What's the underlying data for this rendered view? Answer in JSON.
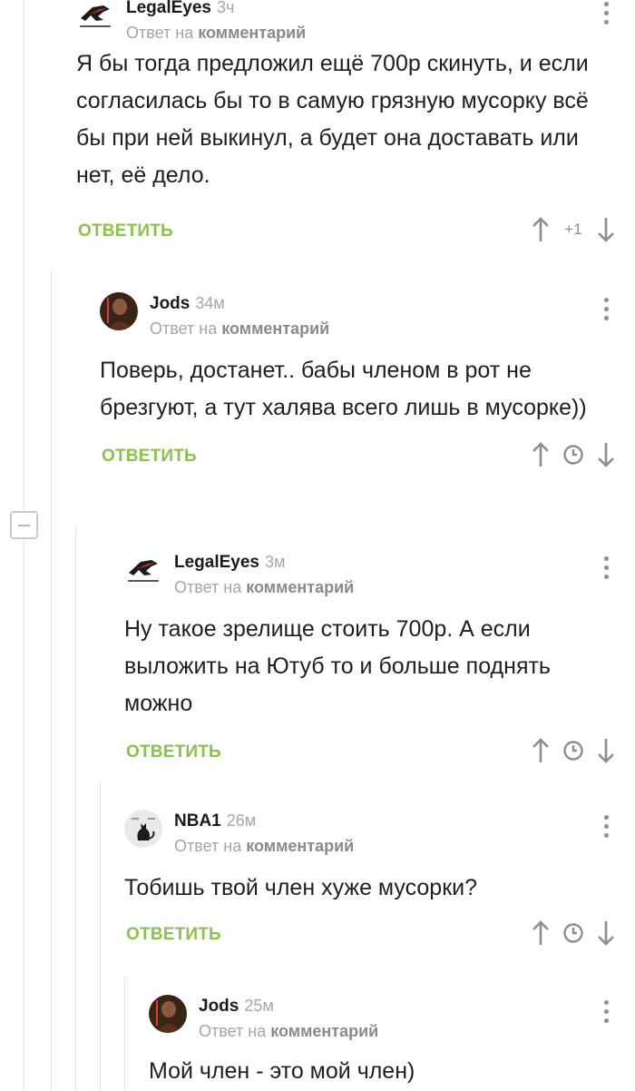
{
  "ui": {
    "reply_label": "ОТВЕТИТЬ",
    "reply_to_prefix": "Ответ на",
    "reply_to_target": "комментарий",
    "accent_color": "#8bc34a"
  },
  "comments": [
    {
      "author": "LegalEyes",
      "age": "3ч",
      "avatar": "rog-logo",
      "text": "Я бы тогда предложил ещё 700р скинуть, и если согласилась бы то в самую грязную мусорку всё бы при ней выкинул, а будет она доставать или нет, её дело.",
      "rating": "+1"
    },
    {
      "author": "Jods",
      "age": "34м",
      "avatar": "dark-portrait",
      "text": "Поверь, достанет.. бабы членом в рот не брезгуют, а тут халява всего лишь в мусорке))",
      "rating": "clock"
    },
    {
      "author": "LegalEyes",
      "age": "3м",
      "avatar": "rog-logo",
      "text": "Ну такое зрелище стоить 700р. А если выложить на Ютуб то и больше поднять можно",
      "rating": "clock"
    },
    {
      "author": "NBA1",
      "age": "26м",
      "avatar": "cat-sketch",
      "text": "Тобишь твой член хуже мусорки?",
      "rating": "clock"
    },
    {
      "author": "Jods",
      "age": "25м",
      "avatar": "dark-portrait",
      "text": "Мой член - это мой член)",
      "rating": "clock"
    }
  ]
}
